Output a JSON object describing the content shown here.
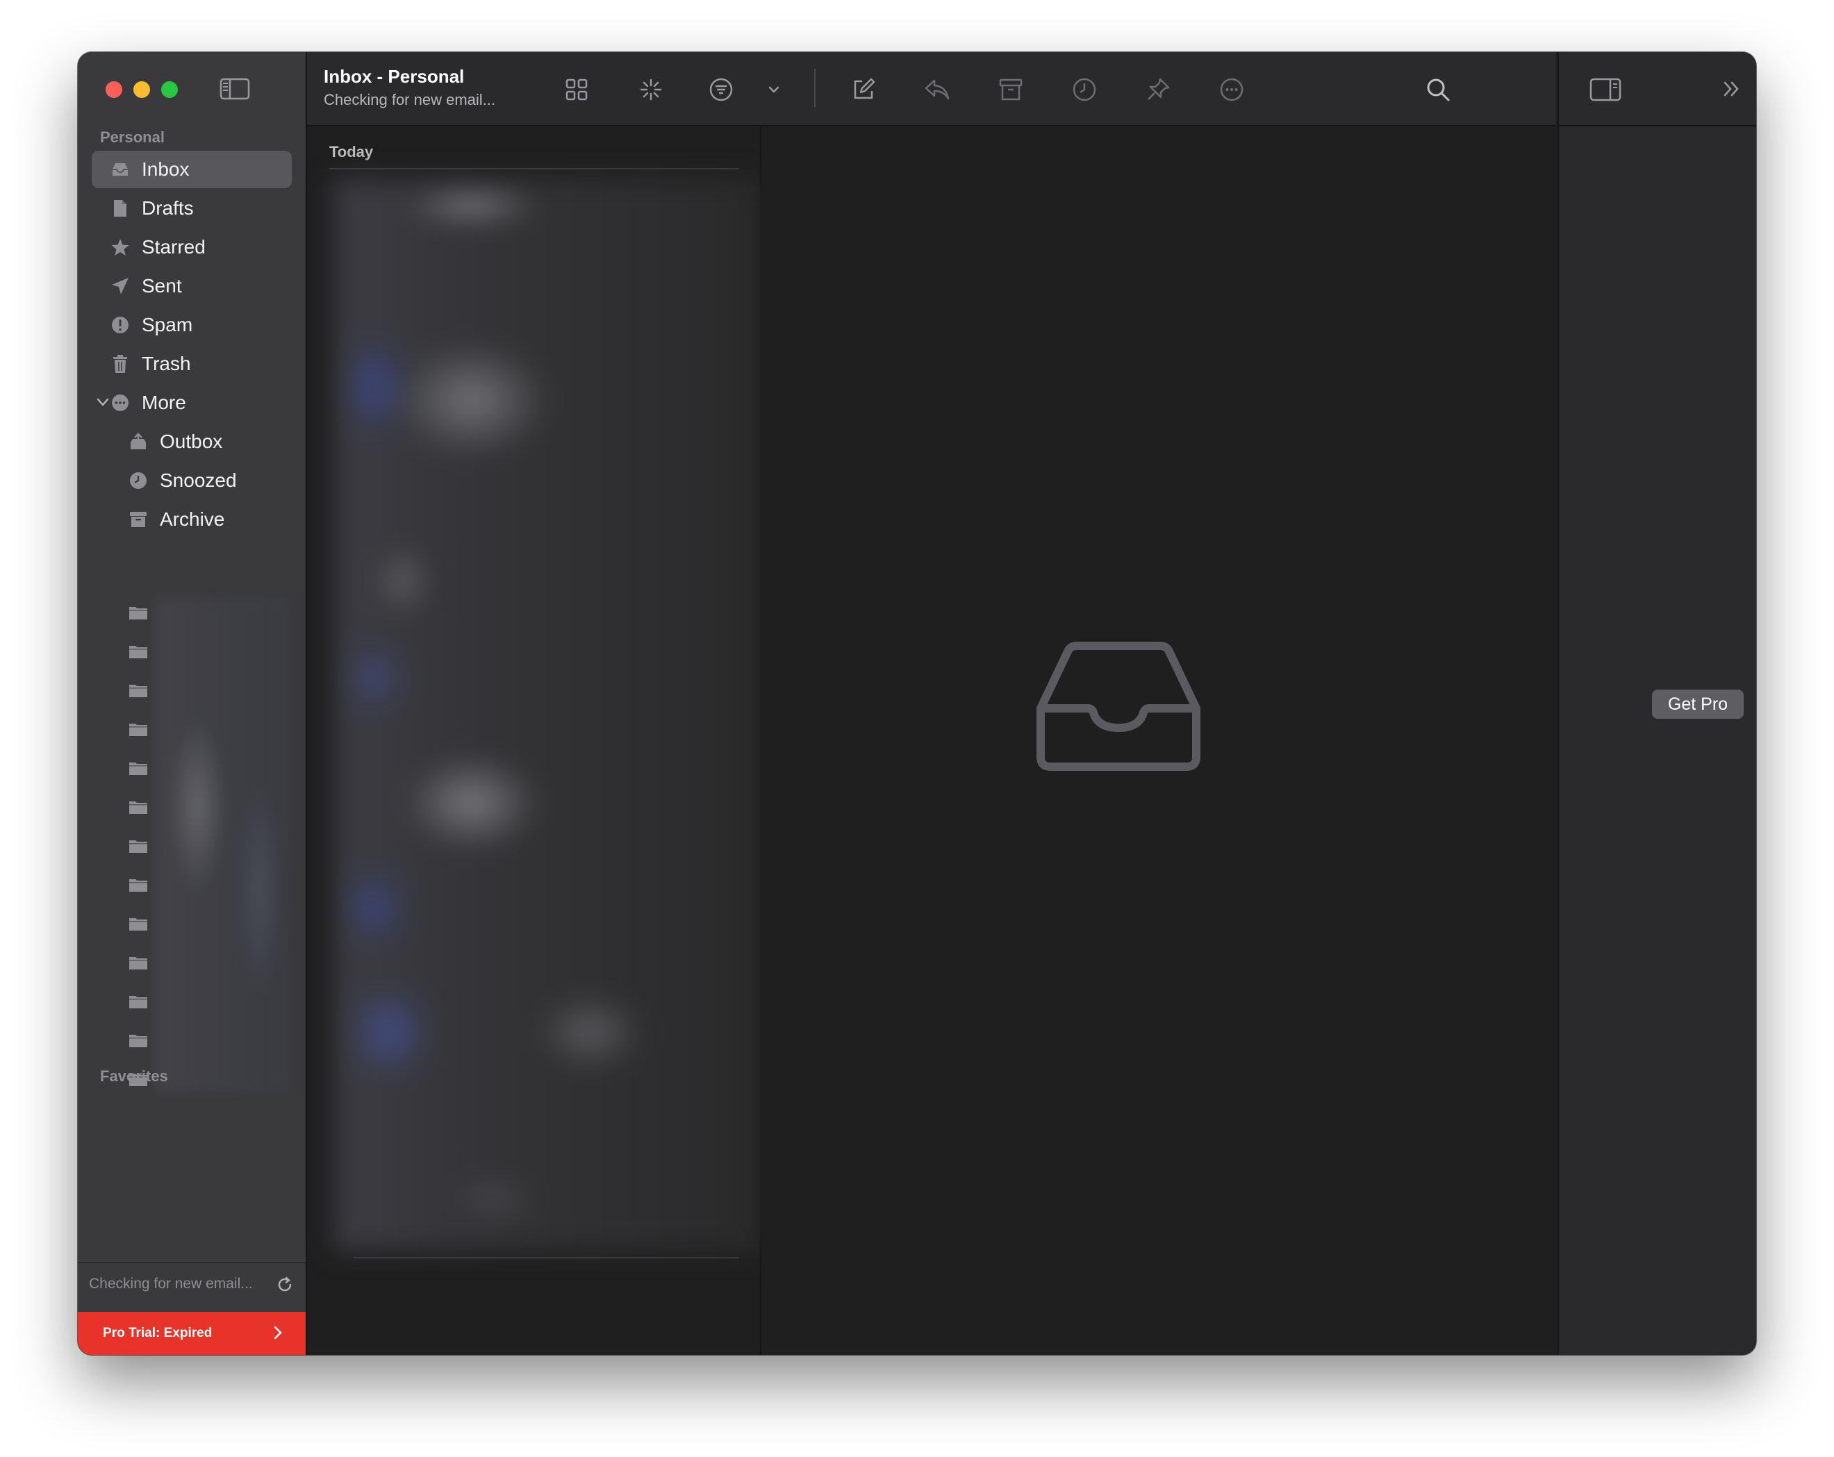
{
  "window": {
    "title": "Inbox - Personal",
    "subtitle": "Checking for new email..."
  },
  "sidebar": {
    "section_personal": "Personal",
    "items": [
      {
        "label": "Inbox",
        "icon": "inbox-tray-icon",
        "selected": true
      },
      {
        "label": "Drafts",
        "icon": "document-icon"
      },
      {
        "label": "Starred",
        "icon": "star-icon"
      },
      {
        "label": "Sent",
        "icon": "paper-plane-icon"
      },
      {
        "label": "Spam",
        "icon": "exclamation-circle-icon"
      },
      {
        "label": "Trash",
        "icon": "trash-icon"
      },
      {
        "label": "More",
        "icon": "ellipsis-circle-icon",
        "expanded": true
      }
    ],
    "more_items": [
      {
        "label": "Outbox",
        "icon": "outbox-tray-icon"
      },
      {
        "label": "Snoozed",
        "icon": "clock-icon"
      },
      {
        "label": "Archive",
        "icon": "archive-box-icon"
      }
    ],
    "section_favorites": "Favorites",
    "status_text": "Checking for new email...",
    "pro_trial_label": "Pro Trial: Expired"
  },
  "toolbar": {
    "icons": [
      "grid-icon",
      "sparkle-icon",
      "filter-icon",
      "chevron-down-icon",
      "compose-icon",
      "reply-icon",
      "archive-icon",
      "snooze-clock-icon",
      "pin-icon",
      "more-icon",
      "search-icon"
    ]
  },
  "list": {
    "group_header": "Today"
  },
  "right_panel": {
    "get_pro_label": "Get Pro"
  },
  "colors": {
    "accent_red": "#e8332b",
    "sidebar_bg": "#3a3a3c",
    "content_bg": "#1f1f1f",
    "toolbar_bg": "#2a2a2c"
  }
}
